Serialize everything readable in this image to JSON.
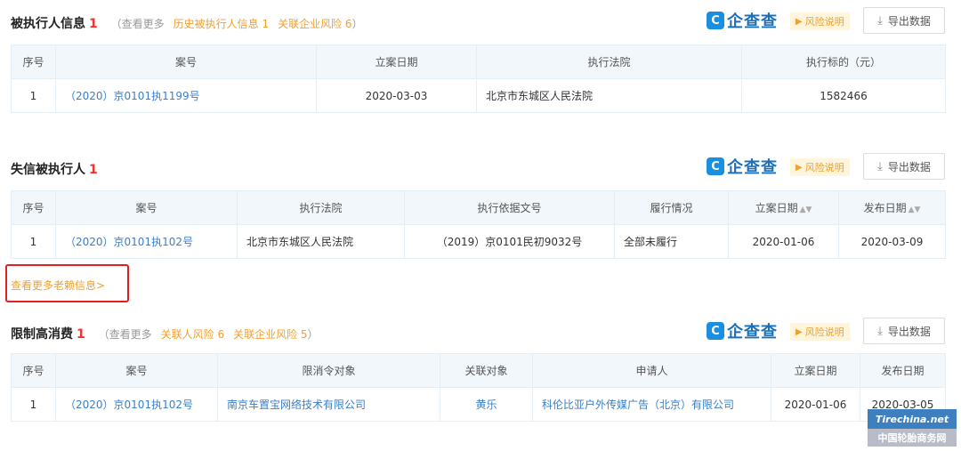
{
  "common": {
    "brand_text": "企查查",
    "brand_badge": "C",
    "risk_label": "风险说明",
    "export_label": "导出数据"
  },
  "section1": {
    "title": "被执行人信息",
    "count": "1",
    "paren_open": "（",
    "see_more": "查看更多",
    "link1": "历史被执行人信息 1",
    "link2": "关联企业风险 6",
    "paren_close": "）",
    "headers": [
      "序号",
      "案号",
      "立案日期",
      "执行法院",
      "执行标的（元）"
    ],
    "rows": [
      {
        "no": "1",
        "case_no": "（2020）京0101执1199号",
        "date": "2020-03-03",
        "court": "北京市东城区人民法院",
        "amount": "1582466"
      }
    ]
  },
  "section2": {
    "title": "失信被执行人",
    "count": "1",
    "headers": [
      "序号",
      "案号",
      "执行法院",
      "执行依据文号",
      "履行情况",
      "立案日期",
      "发布日期"
    ],
    "rows": [
      {
        "no": "1",
        "case_no": "（2020）京0101执102号",
        "court": "北京市东城区人民法院",
        "basis_no": "（2019）京0101民初9032号",
        "status": "全部未履行",
        "file_date": "2020-01-06",
        "publish_date": "2020-03-09"
      }
    ],
    "more_link": "查看更多老赖信息>"
  },
  "section3": {
    "title": "限制高消费",
    "count": "1",
    "paren_open": "（",
    "see_more": "查看更多",
    "link1": "关联人风险 6",
    "link2": "关联企业风险 5",
    "paren_close": "）",
    "headers": [
      "序号",
      "案号",
      "限消令对象",
      "关联对象",
      "申请人",
      "立案日期",
      "发布日期"
    ],
    "rows": [
      {
        "no": "1",
        "case_no": "（2020）京0101执102号",
        "target": "南京车置宝网络技术有限公司",
        "related": "黄乐",
        "applicant": "科伦比亚户外传媒广告（北京）有限公司",
        "file_date": "2020-01-06",
        "publish_date": "2020-03-05"
      }
    ]
  },
  "watermark": {
    "top": "Tirechina.net",
    "bottom": "中国轮胎商务网"
  },
  "colors": {
    "accent_red": "#e33333",
    "link_blue": "#3a7fc9",
    "orange": "#f0a030",
    "header_bg": "#f2f7fb"
  }
}
